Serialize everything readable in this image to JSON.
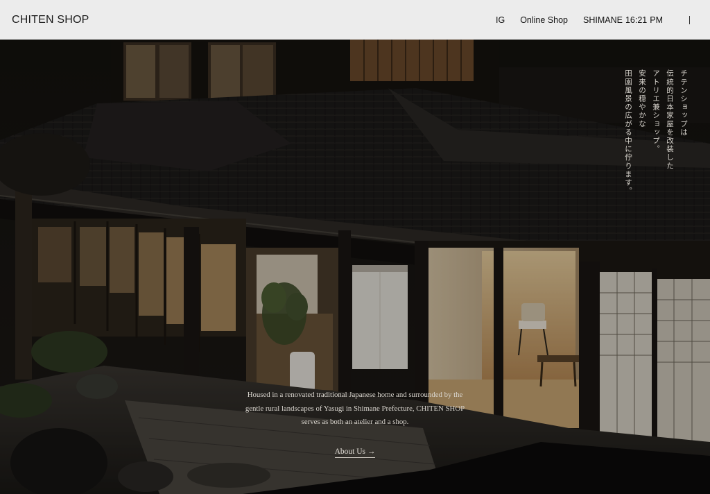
{
  "header": {
    "logo": "CHITEN SHOP",
    "nav": {
      "ig": "IG",
      "online_shop": "Online Shop",
      "location": "SHIMANE",
      "time": "16:21",
      "ampm": "PM"
    }
  },
  "hero": {
    "vertical_lines": [
      "チテンショップは",
      "伝統的日本家屋を改装した",
      "アトリエ兼ショップ。",
      "安来の穏やかな",
      "田園風景の広がる中に佇ります。"
    ],
    "description_lines": [
      "Housed in a renovated traditional Japanese home and surrounded by the",
      "gentle rural landscapes of Yasugi in Shimane Prefecture, CHITEN SHOP",
      "serves as both an atelier and a shop."
    ],
    "cta": "About Us →"
  },
  "colors": {
    "header_bg": "#ececec",
    "text_light": "#d9d5ce",
    "warm_glow": "#e7c590"
  }
}
